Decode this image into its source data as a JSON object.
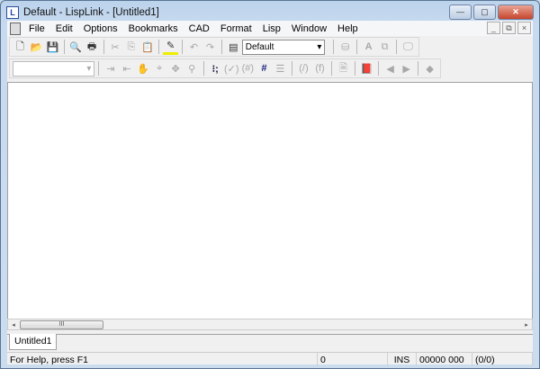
{
  "window": {
    "title": "Default - LispLink - [Untitled1]",
    "minimize": "—",
    "maximize": "▢",
    "close": "✕"
  },
  "menu": {
    "items": [
      "File",
      "Edit",
      "Options",
      "Bookmarks",
      "CAD",
      "Format",
      "Lisp",
      "Window",
      "Help"
    ],
    "mdi_min": "_",
    "mdi_restore": "⧉",
    "mdi_close": "×"
  },
  "toolbar": {
    "style_combo": "Default",
    "combo_arrow": "▾",
    "empty_combo": ""
  },
  "editor": {
    "scroll_grip": "III",
    "scroll_left": "◂",
    "scroll_right": "▸"
  },
  "tabs": [
    {
      "label": "Untitled1"
    }
  ],
  "status": {
    "help": "For Help, press F1",
    "count": "0",
    "mode": "INS",
    "position": "00000 000",
    "ratio": "(0/0)"
  }
}
